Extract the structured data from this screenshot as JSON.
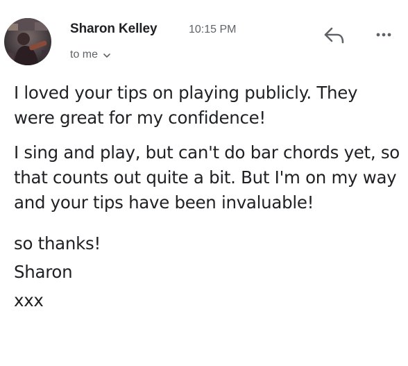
{
  "message": {
    "sender_name": "Sharon Kelley",
    "timestamp": "10:15 PM",
    "recipient_label": "to me",
    "avatar_icon": "profile-photo",
    "reply_icon": "reply-icon",
    "more_icon": "more-horizontal-icon",
    "body_paragraphs": [
      "I loved your tips on playing publicly. They were great for my confidence!",
      "I sing and play, but can't do bar chords yet, so that counts out quite a bit. But I'm on my way and your tips have been invaluable!"
    ],
    "closing_lines": [
      "so thanks!",
      "Sharon",
      "xxx"
    ]
  },
  "colors": {
    "text_primary": "#202124",
    "text_secondary": "#5f6368",
    "icon": "#5f6368"
  }
}
